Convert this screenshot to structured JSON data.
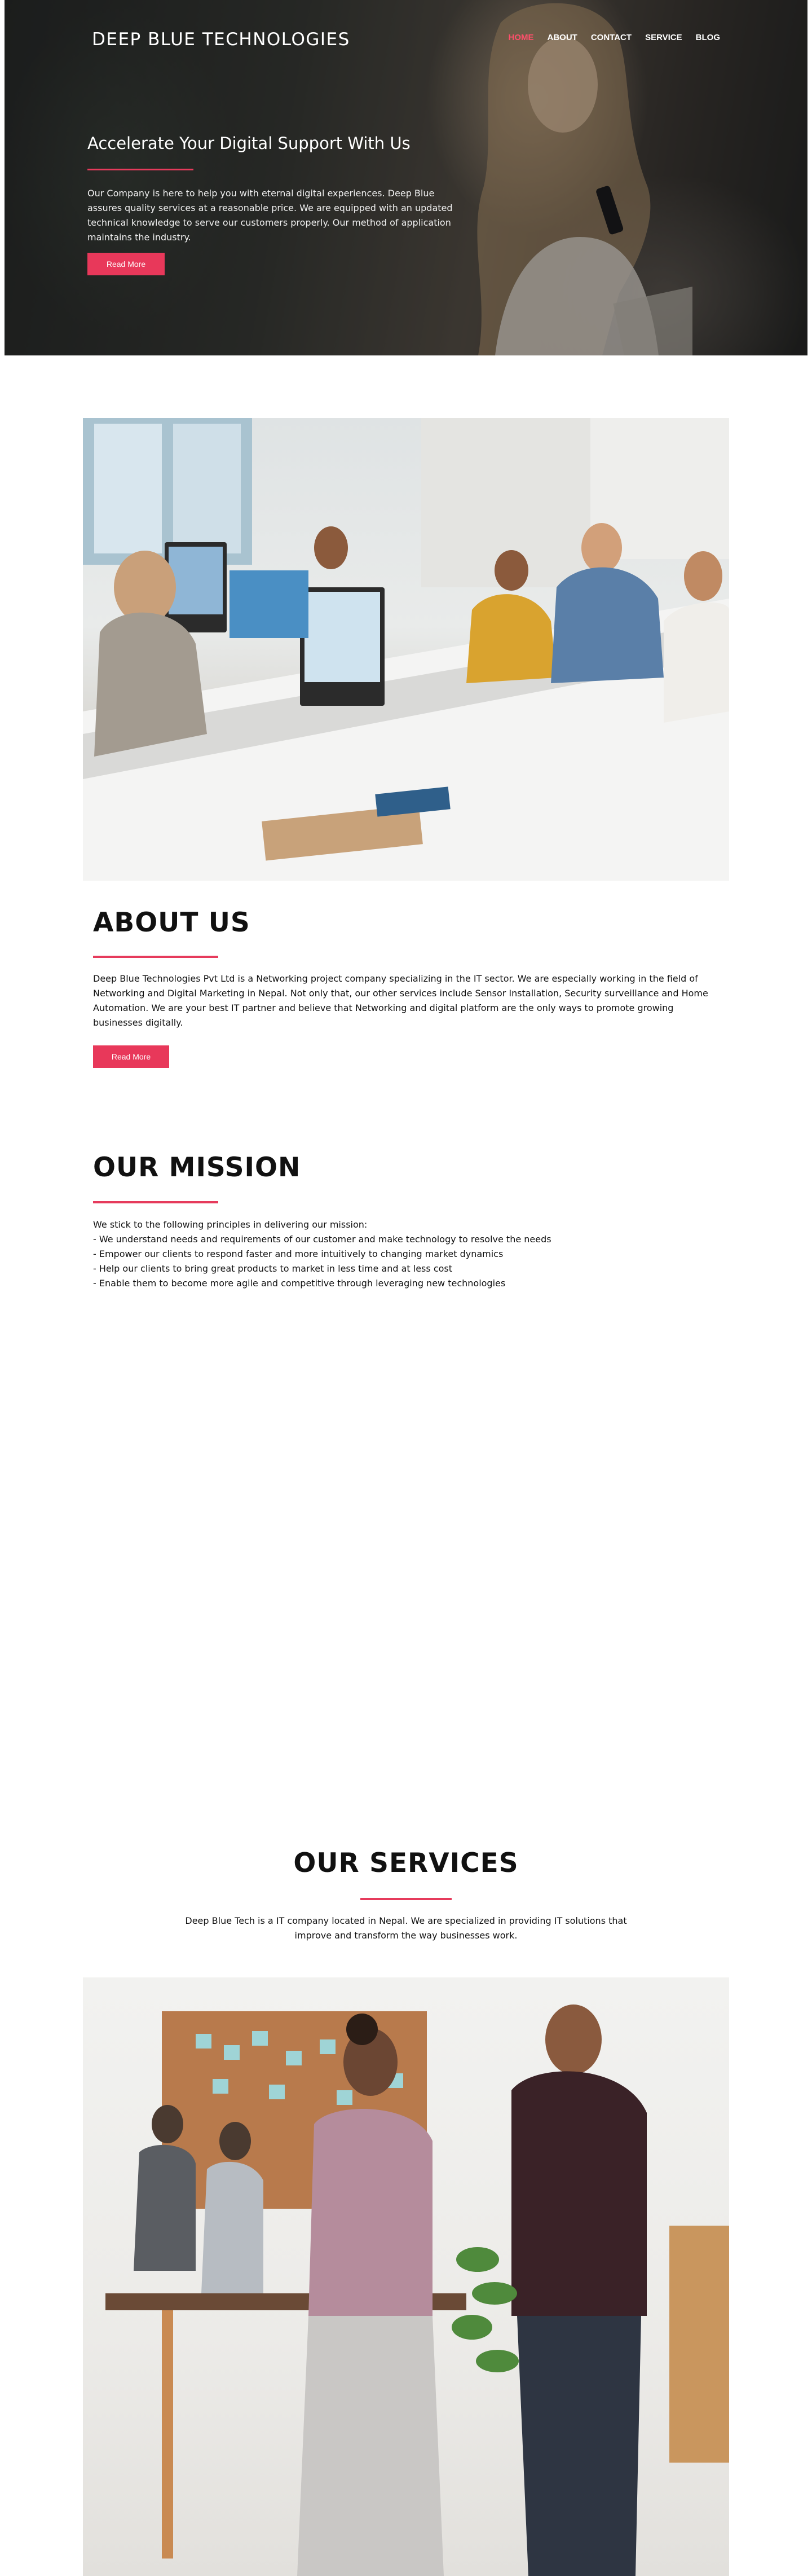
{
  "header": {
    "brand": "DEEP BLUE TECHNOLOGIES",
    "nav": [
      {
        "label": "HOME",
        "active": true
      },
      {
        "label": "ABOUT",
        "active": false
      },
      {
        "label": "CONTACT",
        "active": false
      },
      {
        "label": "SERVICE",
        "active": false
      },
      {
        "label": "BLOG",
        "active": false
      }
    ]
  },
  "hero": {
    "heading": "Accelerate Your Digital Support With Us",
    "text": "Our Company is here to help you with eternal digital experiences. Deep Blue assures quality services at a reasonable price. We are equipped with an updated technical knowledge to serve our customers properly. Our method of application maintains the industry.",
    "button": "Read More"
  },
  "about": {
    "title": "ABOUT US",
    "text": "Deep Blue Technologies Pvt Ltd is a Networking project company specializing in the IT sector. We are especially working in the field of Networking and Digital Marketing in Nepal. Not only that, our other services include Sensor Installation, Security surveillance and Home Automation. We are your best IT partner and believe that Networking and digital platform are the only ways to promote growing businesses digitally.",
    "button": "Read More"
  },
  "mission": {
    "title": "OUR MISSION",
    "intro": "We stick to the following principles in delivering our mission:",
    "points": [
      "- We understand needs and requirements of our customer and make technology to resolve the needs",
      "- Empower our clients to respond faster and more intuitively to changing market dynamics",
      "- Help our clients to bring great products to market in less time and at less cost",
      "- Enable them to become more agile and competitive through leveraging new technologies"
    ]
  },
  "services": {
    "title": "OUR SERVICES",
    "text": "Deep Blue Tech is a IT company located in Nepal. We are specialized in providing IT solutions that improve and transform the way businesses work."
  },
  "colors": {
    "accent": "#e8385a",
    "nav_active": "#ff4f6b",
    "text": "#111111"
  }
}
